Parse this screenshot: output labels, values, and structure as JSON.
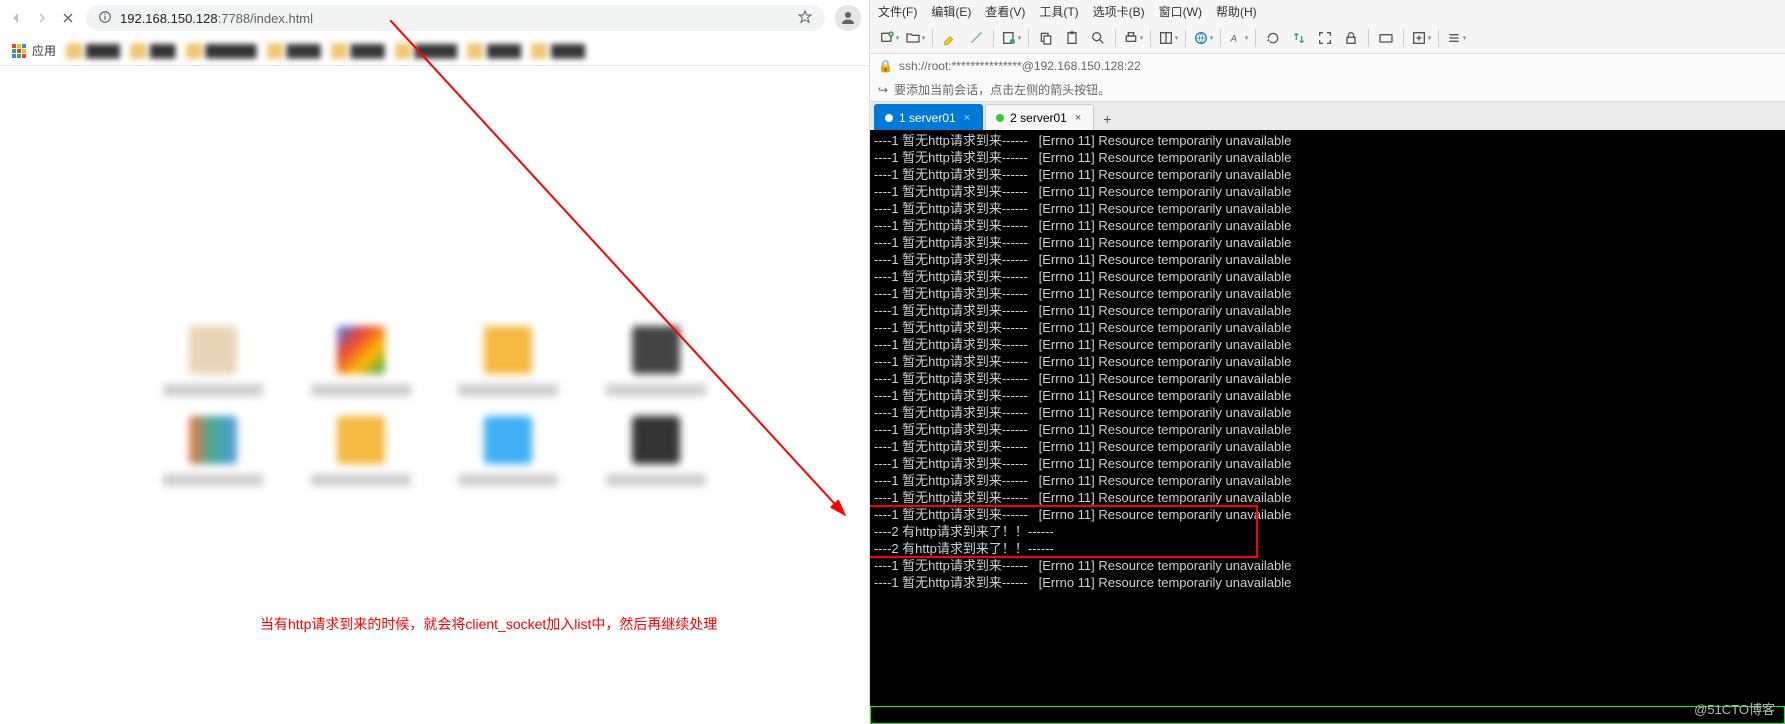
{
  "chrome": {
    "url_prefix": "192.168.150.128",
    "url_port": ":7788",
    "url_path": "/index.html",
    "apps_label": "应用",
    "annotation": "当有http请求到来的时候，就会将client_socket加入list中，然后再继续处理"
  },
  "term": {
    "menus": [
      "文件(F)",
      "编辑(E)",
      "查看(V)",
      "工具(T)",
      "选项卡(B)",
      "窗口(W)",
      "帮助(H)"
    ],
    "address": "ssh://root:***************@192.168.150.128:22",
    "hint": "要添加当前会话，点击左侧的箭头按钮。",
    "tabs": [
      {
        "label": "1 server01",
        "active": true
      },
      {
        "label": "2 server01",
        "active": false
      }
    ],
    "log_line_noop": "----1 暂无http请求到来------   [Errno 11] Resource temporarily unavailable",
    "log_line_hit": "----2 有http请求到来了！！------",
    "noop_count_before": 23,
    "hit_count": 2,
    "noop_count_after": 2
  },
  "watermark": "@51CTO博客"
}
